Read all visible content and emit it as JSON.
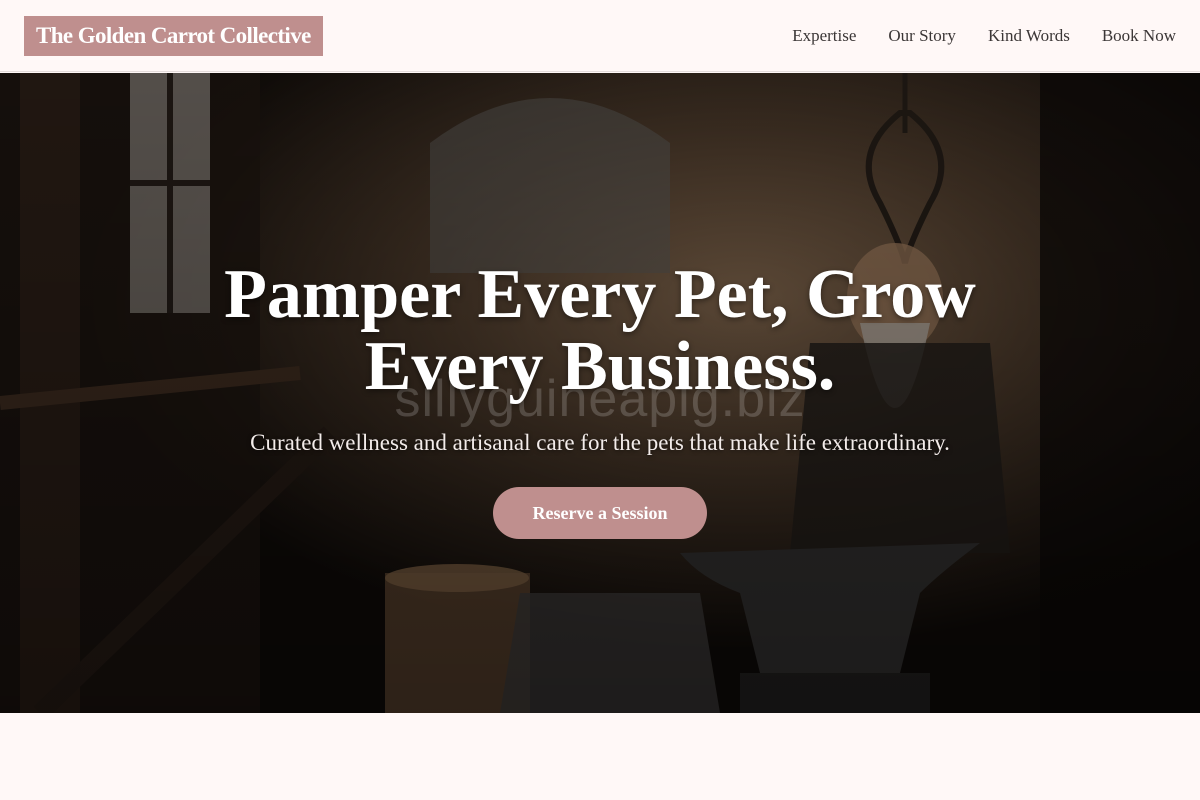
{
  "brand": {
    "name": "The Golden Carrot Collective"
  },
  "nav": {
    "items": [
      {
        "label": "Expertise"
      },
      {
        "label": "Our Story"
      },
      {
        "label": "Kind Words"
      },
      {
        "label": "Book Now"
      }
    ]
  },
  "hero": {
    "headline": "Pamper Every Pet, Grow Every Business.",
    "watermark": "sillyguineapig.biz",
    "subheadline": "Curated wellness and artisanal care for the pets that make life extraordinary.",
    "cta_label": "Reserve a Session"
  },
  "colors": {
    "accent": "#bf8f8e",
    "page_background": "#fff8f7",
    "nav_text": "#3b3636"
  }
}
